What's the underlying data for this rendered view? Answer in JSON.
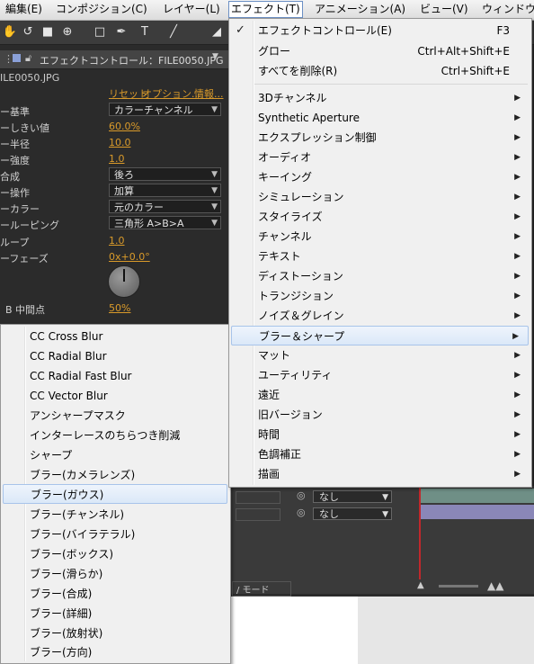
{
  "menubar": {
    "items": [
      "編集(E)",
      "コンポジション(C)",
      "レイヤー(L)",
      "エフェクト(T)",
      "アニメーション(A)",
      "ビュー(V)",
      "ウィンドウ"
    ]
  },
  "toolbar": {
    "tools": [
      "hand-tool-icon",
      "rotate-tool-icon",
      "camera-tool-icon",
      "pan-behind-icon",
      "rectangle-tool-icon",
      "pen-tool-icon",
      "type-tool-icon",
      "brush-tool-icon",
      "eraser-tool-icon"
    ]
  },
  "effect_panel": {
    "tab_title": "エフェクトコントロール：FILE0050.JPG",
    "file_label": "ILE0050.JPG",
    "reset": "リセット",
    "options": "オプション...",
    "info": "情報...",
    "rows": [
      {
        "label": "ー基準",
        "kind": "dropdown",
        "value": "カラーチャンネル"
      },
      {
        "label": "ーしきい値",
        "kind": "value",
        "value": "60.0%"
      },
      {
        "label": "ー半径",
        "kind": "value",
        "value": "10.0"
      },
      {
        "label": "ー強度",
        "kind": "value",
        "value": "1.0"
      },
      {
        "label": "合成",
        "kind": "dropdown",
        "value": "後ろ"
      },
      {
        "label": "ー操作",
        "kind": "dropdown",
        "value": "加算"
      },
      {
        "label": "ーカラー",
        "kind": "dropdown",
        "value": "元のカラー"
      },
      {
        "label": "ールーピング",
        "kind": "dropdown",
        "value": "三角形 A>B>A"
      },
      {
        "label": "ループ",
        "kind": "value",
        "value": "1.0"
      },
      {
        "label": "ーフェーズ",
        "kind": "value",
        "value": "0x+0.0°"
      },
      {
        "label": "B 中間点",
        "kind": "value",
        "value": "50%"
      }
    ]
  },
  "timeline": {
    "mode_label": "/ モード",
    "row1_dropdown": "なし",
    "row2_dropdown": "なし"
  },
  "effect_menu": {
    "check_item": "エフェクトコントロール(E)",
    "check_shortcut": "F3",
    "items": [
      {
        "label": "グロー",
        "shortcut": "Ctrl+Alt+Shift+E"
      },
      {
        "label": "すべてを削除(R)",
        "shortcut": "Ctrl+Shift+E"
      }
    ],
    "categories": [
      "3Dチャンネル",
      "Synthetic Aperture",
      "エクスプレッション制御",
      "オーディオ",
      "キーイング",
      "シミュレーション",
      "スタイライズ",
      "チャンネル",
      "テキスト",
      "ディストーション",
      "トランジション",
      "ノイズ＆グレイン",
      "ブラー＆シャープ",
      "マット",
      "ユーティリティ",
      "遠近",
      "旧バージョン",
      "時間",
      "色調補正",
      "描画"
    ],
    "highlighted_index": 12
  },
  "blur_submenu": {
    "items": [
      "CC Cross Blur",
      "CC Radial Blur",
      "CC Radial Fast Blur",
      "CC Vector Blur",
      "アンシャープマスク",
      "インターレースのちらつき削減",
      "シャープ",
      "ブラー(カメラレンズ)",
      "ブラー(ガウス)",
      "ブラー(チャンネル)",
      "ブラー(バイラテラル)",
      "ブラー(ボックス)",
      "ブラー(滑らか)",
      "ブラー(合成)",
      "ブラー(詳細)",
      "ブラー(放射状)",
      "ブラー(方向)"
    ],
    "highlighted_index": 8
  },
  "colors": {
    "accent_orange": "#d99a2a",
    "menu_bg": "#f0f0f0",
    "highlight_border": "#a8c4ea",
    "panel_bg": "#2b2b2b"
  }
}
